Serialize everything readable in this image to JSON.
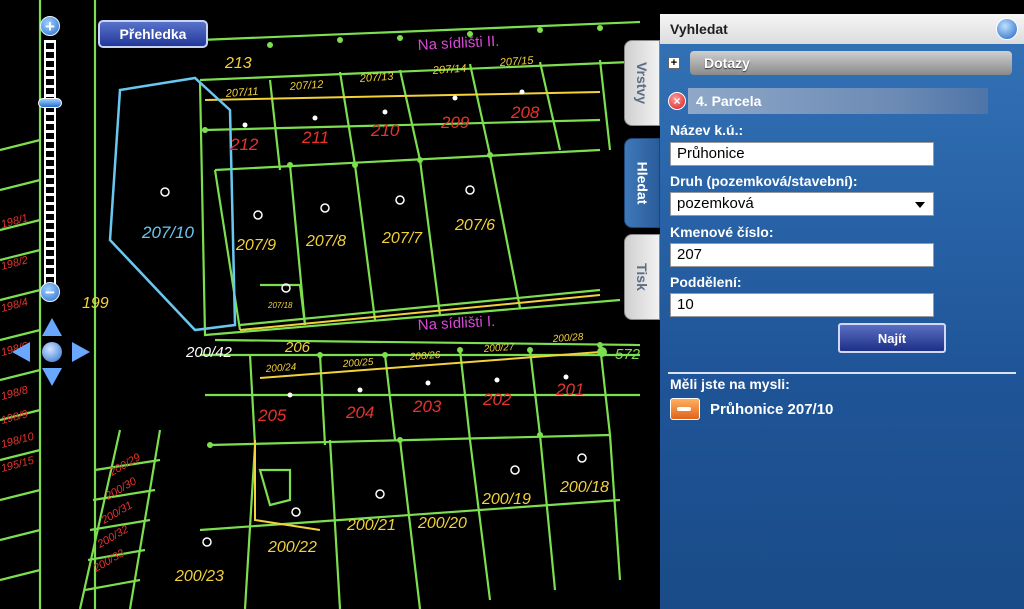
{
  "map": {
    "overview_button": "Přehledka",
    "street_labels": [
      {
        "text": "Na sídlišti II."
      },
      {
        "text": "Na sídlišti I."
      }
    ],
    "parcels": [
      {
        "id": "213",
        "style": "yellow"
      },
      {
        "id": "207/11",
        "style": "yellow"
      },
      {
        "id": "207/12",
        "style": "yellow"
      },
      {
        "id": "207/13",
        "style": "yellow"
      },
      {
        "id": "207/14",
        "style": "yellow"
      },
      {
        "id": "207/15",
        "style": "yellow"
      },
      {
        "id": "212",
        "style": "red"
      },
      {
        "id": "211",
        "style": "red"
      },
      {
        "id": "210",
        "style": "red"
      },
      {
        "id": "209",
        "style": "red"
      },
      {
        "id": "208",
        "style": "red"
      },
      {
        "id": "207/10",
        "style": "cyan"
      },
      {
        "id": "207/9",
        "style": "yellow"
      },
      {
        "id": "207/8",
        "style": "yellow"
      },
      {
        "id": "207/7",
        "style": "yellow"
      },
      {
        "id": "207/6",
        "style": "yellow"
      },
      {
        "id": "207/18",
        "style": "yellow"
      },
      {
        "id": "199",
        "style": "yellow"
      },
      {
        "id": "200/42",
        "style": "white"
      },
      {
        "id": "206",
        "style": "yellow"
      },
      {
        "id": "200/24",
        "style": "yellow"
      },
      {
        "id": "200/25",
        "style": "yellow"
      },
      {
        "id": "200/26",
        "style": "yellow"
      },
      {
        "id": "200/27",
        "style": "yellow"
      },
      {
        "id": "200/28",
        "style": "yellow"
      },
      {
        "id": "572",
        "style": "green"
      },
      {
        "id": "205",
        "style": "red"
      },
      {
        "id": "204",
        "style": "red"
      },
      {
        "id": "203",
        "style": "red"
      },
      {
        "id": "202",
        "style": "red"
      },
      {
        "id": "201",
        "style": "red"
      },
      {
        "id": "200/19",
        "style": "yellow"
      },
      {
        "id": "200/18",
        "style": "yellow"
      },
      {
        "id": "200/21",
        "style": "yellow"
      },
      {
        "id": "200/20",
        "style": "yellow"
      },
      {
        "id": "200/22",
        "style": "yellow"
      },
      {
        "id": "200/23",
        "style": "yellow"
      },
      {
        "id": "198/1",
        "style": "red"
      },
      {
        "id": "198/2",
        "style": "red"
      },
      {
        "id": "198/4",
        "style": "red"
      },
      {
        "id": "198/6",
        "style": "red"
      },
      {
        "id": "198/8",
        "style": "red"
      },
      {
        "id": "198/9",
        "style": "red"
      },
      {
        "id": "198/10",
        "style": "red"
      },
      {
        "id": "195/15",
        "style": "red"
      },
      {
        "id": "200/29",
        "style": "red"
      },
      {
        "id": "200/30",
        "style": "red"
      },
      {
        "id": "200/31",
        "style": "red"
      },
      {
        "id": "200/32",
        "style": "red"
      },
      {
        "id": "200/33",
        "style": "red"
      }
    ]
  },
  "tabs": [
    {
      "label": "Vrstvy",
      "active": false
    },
    {
      "label": "Hledat",
      "active": true
    },
    {
      "label": "Tisk",
      "active": false
    }
  ],
  "panel": {
    "title": "Vyhledat",
    "queries_label": "Dotazy",
    "section_label": "4. Parcela",
    "fields": {
      "cadastral_label": "Název k.ú.:",
      "cadastral_value": "Průhonice",
      "type_label": "Druh (pozemková/stavební):",
      "type_value": "pozemková",
      "number_label": "Kmenové číslo:",
      "number_value": "207",
      "subdivision_label": "Poddělení:",
      "subdivision_value": "10"
    },
    "search_button": "Najít",
    "suggest_label": "Měli jste na mysli:",
    "suggest_result": "Průhonice 207/10"
  },
  "colors": {
    "map_bg": "#000000",
    "parcel_line": "#7ddf4f",
    "label_yellow": "#f2d13a",
    "label_red": "#e8332d",
    "label_cyan": "#6ac8f0",
    "street_magenta": "#d94ad6",
    "panel_blue": "#2a64a8"
  }
}
